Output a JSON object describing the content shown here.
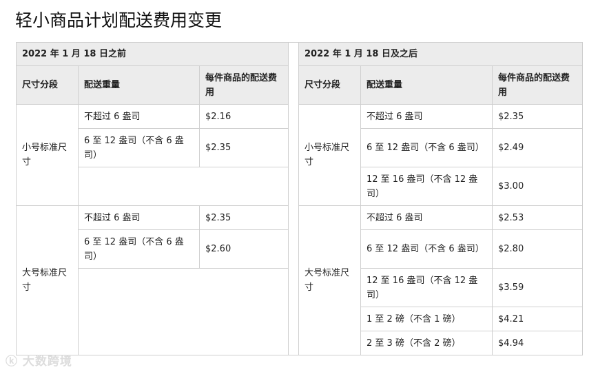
{
  "title": "轻小商品计划配送费用变更",
  "before": {
    "period": "2022 年 1 月 18 日之前",
    "headers": [
      "尺寸分段",
      "配送重量",
      "每件商品的配送费用"
    ],
    "small": {
      "tier": "小号标准尺寸",
      "rows": [
        [
          "不超过 6 盎司",
          "$2.16"
        ],
        [
          "6 至 12 盎司（不含 6 盎司）",
          "$2.35"
        ]
      ]
    },
    "large": {
      "tier": "大号标准尺寸",
      "rows": [
        [
          "不超过 6 盎司",
          "$2.35"
        ],
        [
          "6 至 12 盎司（不含 6 盎司）",
          "$2.60"
        ]
      ]
    }
  },
  "after": {
    "period": "2022 年 1 月 18 日及之后",
    "headers": [
      "尺寸分段",
      "配送重量",
      "每件商品的配送费用"
    ],
    "small": {
      "tier": "小号标准尺寸",
      "rows": [
        [
          "不超过 6 盎司",
          "$2.35"
        ],
        [
          "6 至 12 盎司（不含 6 盎司）",
          "$2.49"
        ],
        [
          "12 至 16 盎司（不含 12 盎司）",
          "$3.00"
        ]
      ]
    },
    "large": {
      "tier": "大号标准尺寸",
      "rows": [
        [
          "不超过 6 盎司",
          "$2.53"
        ],
        [
          "6 至 12 盎司（不含 6 盎司）",
          "$2.80"
        ],
        [
          "12 至 16 盎司（不含 12 盎司）",
          "$3.59"
        ],
        [
          "1 至 2 磅（不含 1 磅）",
          "$4.21"
        ],
        [
          "2 至 3 磅（不含 2 磅）",
          "$4.94"
        ]
      ]
    }
  },
  "watermark": "大数跨境"
}
